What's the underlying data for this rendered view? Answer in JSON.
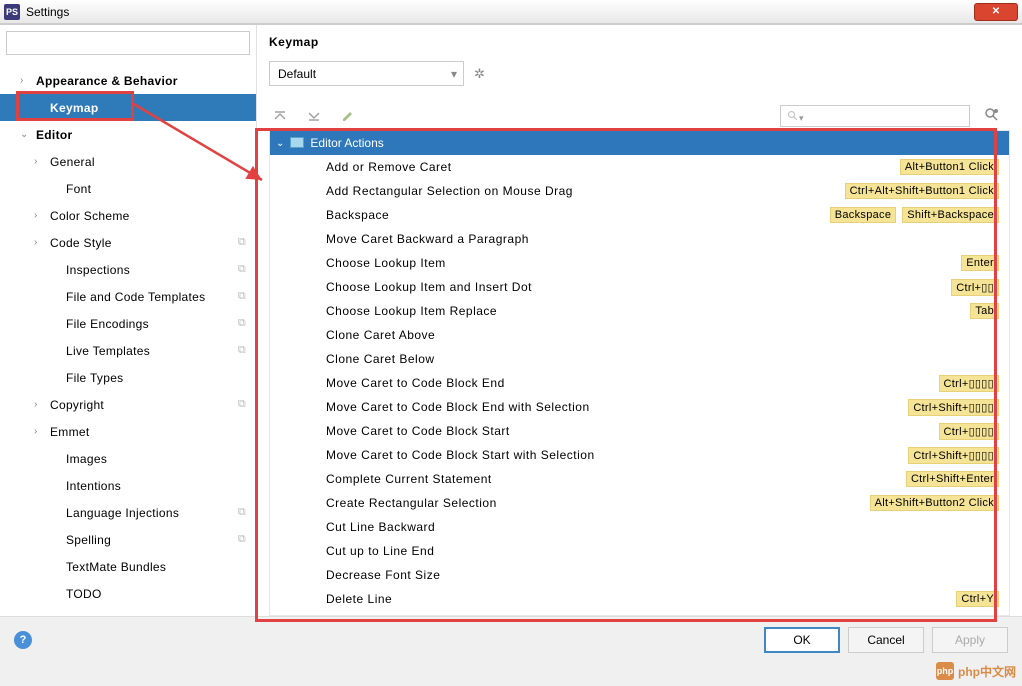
{
  "window": {
    "title": "Settings",
    "app_icon_text": "PS"
  },
  "sidebar": {
    "search_placeholder": "",
    "items": [
      {
        "label": "Appearance & Behavior",
        "level": 0,
        "chev": "›",
        "bold": true
      },
      {
        "label": "Keymap",
        "level": 1,
        "chev": "",
        "bold": true,
        "selected": true
      },
      {
        "label": "Editor",
        "level": 0,
        "chev": "⌄",
        "bold": true
      },
      {
        "label": "General",
        "level": 1,
        "chev": "›",
        "bold": false
      },
      {
        "label": "Font",
        "level": 2,
        "chev": "",
        "bold": false
      },
      {
        "label": "Color Scheme",
        "level": 1,
        "chev": "›",
        "bold": false
      },
      {
        "label": "Code Style",
        "level": 1,
        "chev": "›",
        "bold": false,
        "copy": true
      },
      {
        "label": "Inspections",
        "level": 2,
        "chev": "",
        "bold": false,
        "copy": true
      },
      {
        "label": "File and Code Templates",
        "level": 2,
        "chev": "",
        "bold": false,
        "copy": true
      },
      {
        "label": "File Encodings",
        "level": 2,
        "chev": "",
        "bold": false,
        "copy": true
      },
      {
        "label": "Live Templates",
        "level": 2,
        "chev": "",
        "bold": false,
        "copy": true
      },
      {
        "label": "File Types",
        "level": 2,
        "chev": "",
        "bold": false
      },
      {
        "label": "Copyright",
        "level": 1,
        "chev": "›",
        "bold": false,
        "copy": true
      },
      {
        "label": "Emmet",
        "level": 1,
        "chev": "›",
        "bold": false
      },
      {
        "label": "Images",
        "level": 2,
        "chev": "",
        "bold": false
      },
      {
        "label": "Intentions",
        "level": 2,
        "chev": "",
        "bold": false
      },
      {
        "label": "Language Injections",
        "level": 2,
        "chev": "",
        "bold": false,
        "copy": true
      },
      {
        "label": "Spelling",
        "level": 2,
        "chev": "",
        "bold": false,
        "copy": true
      },
      {
        "label": "TextMate Bundles",
        "level": 2,
        "chev": "",
        "bold": false
      },
      {
        "label": "TODO",
        "level": 2,
        "chev": "",
        "bold": false
      }
    ]
  },
  "content": {
    "title": "Keymap",
    "scheme": "Default",
    "group_header": "Editor Actions",
    "actions": [
      {
        "name": "Add or Remove Caret",
        "shortcuts": [
          "Alt+Button1 Click"
        ]
      },
      {
        "name": "Add Rectangular Selection on Mouse Drag",
        "shortcuts": [
          "Ctrl+Alt+Shift+Button1 Click"
        ]
      },
      {
        "name": "Backspace",
        "shortcuts": [
          "Backspace",
          "Shift+Backspace"
        ]
      },
      {
        "name": "Move Caret Backward a Paragraph",
        "shortcuts": []
      },
      {
        "name": "Choose Lookup Item",
        "shortcuts": [
          "Enter"
        ]
      },
      {
        "name": "Choose Lookup Item and Insert Dot",
        "shortcuts": [
          "Ctrl+▯▯"
        ]
      },
      {
        "name": "Choose Lookup Item Replace",
        "shortcuts": [
          "Tab"
        ]
      },
      {
        "name": "Clone Caret Above",
        "shortcuts": []
      },
      {
        "name": "Clone Caret Below",
        "shortcuts": []
      },
      {
        "name": "Move Caret to Code Block End",
        "shortcuts": [
          "Ctrl+▯▯▯▯"
        ]
      },
      {
        "name": "Move Caret to Code Block End with Selection",
        "shortcuts": [
          "Ctrl+Shift+▯▯▯▯"
        ]
      },
      {
        "name": "Move Caret to Code Block Start",
        "shortcuts": [
          "Ctrl+▯▯▯▯"
        ]
      },
      {
        "name": "Move Caret to Code Block Start with Selection",
        "shortcuts": [
          "Ctrl+Shift+▯▯▯▯"
        ]
      },
      {
        "name": "Complete Current Statement",
        "shortcuts": [
          "Ctrl+Shift+Enter"
        ]
      },
      {
        "name": "Create Rectangular Selection",
        "shortcuts": [
          "Alt+Shift+Button2 Click"
        ]
      },
      {
        "name": "Cut Line Backward",
        "shortcuts": []
      },
      {
        "name": "Cut up to Line End",
        "shortcuts": []
      },
      {
        "name": "Decrease Font Size",
        "shortcuts": []
      },
      {
        "name": "Delete Line",
        "shortcuts": [
          "Ctrl+Y"
        ]
      }
    ]
  },
  "footer": {
    "ok": "OK",
    "cancel": "Cancel",
    "apply": "Apply"
  },
  "watermark": "php中文网"
}
